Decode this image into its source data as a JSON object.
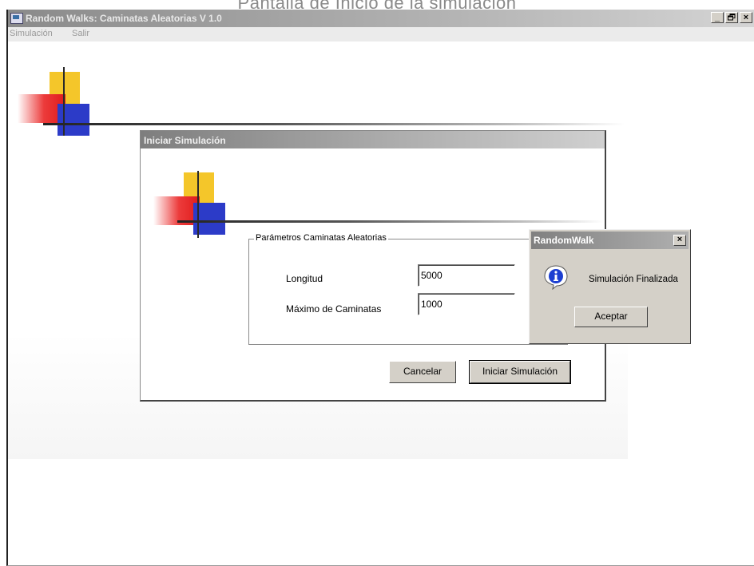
{
  "page_caption": "Pantalla de Inicio de la simulación",
  "window": {
    "title": "Random Walks: Caminatas Aleatorias V 1.0",
    "buttons": {
      "minimize": "_",
      "maximize": "ᴮ",
      "close": "×"
    }
  },
  "menu": {
    "items": [
      {
        "label": "Simulación"
      },
      {
        "label": "Salir"
      }
    ]
  },
  "sim_dialog": {
    "title": "Iniciar Simulación",
    "group_label": "Parámetros Caminatas Aleatorias",
    "fields": [
      {
        "label": "Longitud",
        "value": "5000"
      },
      {
        "label": "Máximo de Caminatas",
        "value": "1000"
      }
    ],
    "cancel_label": "Cancelar",
    "start_label": "Iniciar Simulación"
  },
  "message_box": {
    "title": "RandomWalk",
    "close_label": "×",
    "message": "Simulación Finalizada",
    "ok_label": "Aceptar"
  },
  "colors": {
    "logo_yellow": "#f4c62a",
    "logo_red": "#e01b1b",
    "logo_blue": "#2c3bc8",
    "dialog_face": "#d4d0c8"
  }
}
